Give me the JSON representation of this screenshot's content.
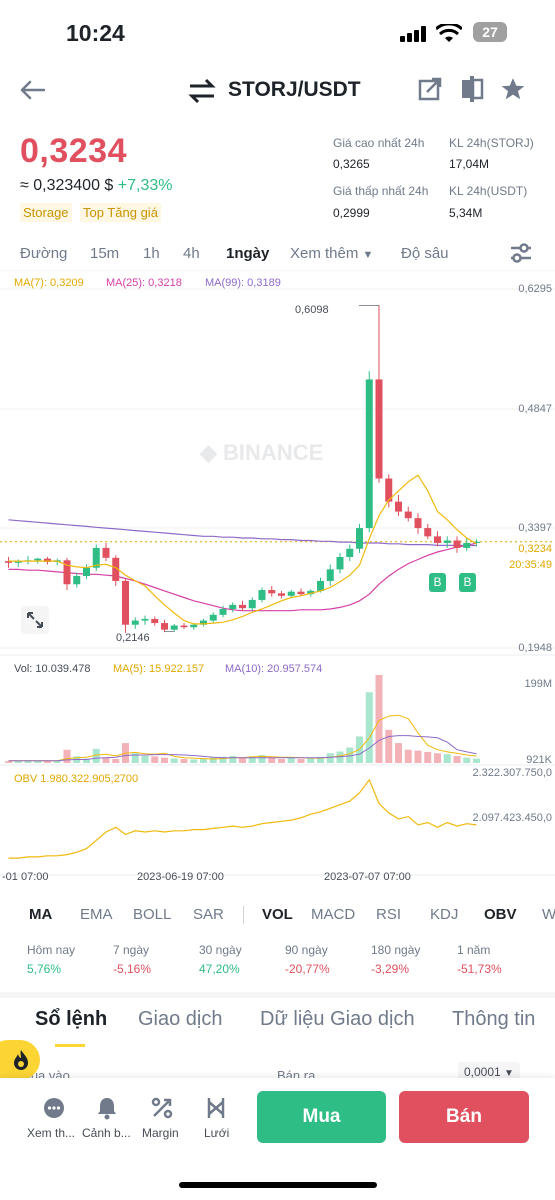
{
  "status": {
    "time": "10:24",
    "battery": "27"
  },
  "header": {
    "pair": "STORJ/USDT"
  },
  "price": {
    "last": "0,3234",
    "approx": "≈ 0,323400 $",
    "change": "+7,33%",
    "tags": [
      "Storage",
      "Top Tăng giá"
    ]
  },
  "stats": {
    "high_label": "Giá cao nhất 24h",
    "high": "0,3265",
    "low_label": "Giá thấp nhất 24h",
    "low": "0,2999",
    "vol_base_label": "KL 24h(STORJ)",
    "vol_base": "17,04M",
    "vol_quote_label": "KL 24h(USDT)",
    "vol_quote": "5,34M"
  },
  "timeframes": [
    "Đường",
    "15m",
    "1h",
    "4h",
    "1ngày",
    "Xem thêm",
    "Độ sâu"
  ],
  "ma_legend": {
    "ma7": "MA(7): 0,3209",
    "ma25": "MA(25): 0,3218",
    "ma99": "MA(99): 0,3189"
  },
  "colors": {
    "up": "#2ebd85",
    "down": "#e0505e",
    "ma7": "#f0b90b",
    "ma25": "#d63fa8",
    "ma99": "#8e6ac8",
    "accent": "#fcd535"
  },
  "chart_data": [
    {
      "type": "candlestick",
      "title": "STORJ/USDT 1ngày",
      "y_ticks": [
        "0,6295",
        "0,4847",
        "0,3397",
        "0,1948"
      ],
      "ylim": [
        0.1948,
        0.6295
      ],
      "annotations": {
        "high": "0,6098",
        "low": "0,2146",
        "last": "0,3234",
        "countdown": "20:35:49"
      },
      "x_ticks": [
        "-01 07:00",
        "2023-06-19 07:00",
        "2023-07-07 07:00"
      ],
      "markers": [
        "B",
        "B"
      ],
      "candles": [
        [
          0.3,
          0.305,
          0.292,
          0.298
        ],
        [
          0.298,
          0.302,
          0.293,
          0.3
        ],
        [
          0.3,
          0.306,
          0.296,
          0.301
        ],
        [
          0.301,
          0.304,
          0.297,
          0.303
        ],
        [
          0.303,
          0.305,
          0.296,
          0.299
        ],
        [
          0.299,
          0.303,
          0.295,
          0.301
        ],
        [
          0.301,
          0.304,
          0.265,
          0.272
        ],
        [
          0.272,
          0.286,
          0.268,
          0.282
        ],
        [
          0.282,
          0.296,
          0.278,
          0.292
        ],
        [
          0.292,
          0.32,
          0.288,
          0.316
        ],
        [
          0.316,
          0.322,
          0.3,
          0.304
        ],
        [
          0.304,
          0.307,
          0.27,
          0.276
        ],
        [
          0.276,
          0.278,
          0.213,
          0.223
        ],
        [
          0.223,
          0.232,
          0.218,
          0.228
        ],
        [
          0.228,
          0.234,
          0.223,
          0.23
        ],
        [
          0.23,
          0.233,
          0.222,
          0.225
        ],
        [
          0.225,
          0.229,
          0.214,
          0.217
        ],
        [
          0.217,
          0.224,
          0.215,
          0.222
        ],
        [
          0.222,
          0.225,
          0.218,
          0.22
        ],
        [
          0.22,
          0.225,
          0.217,
          0.223
        ],
        [
          0.223,
          0.23,
          0.221,
          0.228
        ],
        [
          0.228,
          0.238,
          0.226,
          0.235
        ],
        [
          0.235,
          0.246,
          0.232,
          0.242
        ],
        [
          0.242,
          0.25,
          0.238,
          0.247
        ],
        [
          0.247,
          0.252,
          0.24,
          0.243
        ],
        [
          0.243,
          0.256,
          0.24,
          0.253
        ],
        [
          0.253,
          0.268,
          0.25,
          0.265
        ],
        [
          0.265,
          0.27,
          0.257,
          0.261
        ],
        [
          0.261,
          0.264,
          0.255,
          0.258
        ],
        [
          0.258,
          0.265,
          0.255,
          0.263
        ],
        [
          0.263,
          0.267,
          0.258,
          0.26
        ],
        [
          0.26,
          0.266,
          0.257,
          0.264
        ],
        [
          0.264,
          0.28,
          0.262,
          0.276
        ],
        [
          0.276,
          0.296,
          0.27,
          0.29
        ],
        [
          0.29,
          0.31,
          0.285,
          0.305
        ],
        [
          0.305,
          0.32,
          0.3,
          0.315
        ],
        [
          0.315,
          0.345,
          0.31,
          0.34
        ],
        [
          0.34,
          0.53,
          0.335,
          0.52
        ],
        [
          0.52,
          0.6098,
          0.395,
          0.4
        ],
        [
          0.4,
          0.405,
          0.365,
          0.372
        ],
        [
          0.372,
          0.38,
          0.355,
          0.36
        ],
        [
          0.36,
          0.366,
          0.348,
          0.352
        ],
        [
          0.352,
          0.358,
          0.333,
          0.34
        ],
        [
          0.34,
          0.345,
          0.327,
          0.33
        ],
        [
          0.33,
          0.336,
          0.318,
          0.322
        ],
        [
          0.322,
          0.33,
          0.316,
          0.325
        ],
        [
          0.325,
          0.33,
          0.31,
          0.316
        ],
        [
          0.316,
          0.328,
          0.312,
          0.322
        ],
        [
          0.322,
          0.3265,
          0.318,
          0.3234
        ]
      ],
      "ma7": [
        0.3,
        0.3,
        0.3,
        0.3,
        0.3,
        0.3,
        0.295,
        0.293,
        0.292,
        0.295,
        0.296,
        0.292,
        0.283,
        0.276,
        0.27,
        0.258,
        0.247,
        0.237,
        0.228,
        0.224,
        0.224,
        0.225,
        0.226,
        0.229,
        0.233,
        0.238,
        0.242,
        0.247,
        0.252,
        0.256,
        0.258,
        0.261,
        0.264,
        0.268,
        0.275,
        0.283,
        0.295,
        0.327,
        0.355,
        0.374,
        0.385,
        0.396,
        0.404,
        0.385,
        0.36,
        0.35,
        0.338,
        0.328,
        0.3209
      ],
      "ma25": [
        0.29,
        0.29,
        0.289,
        0.289,
        0.288,
        0.287,
        0.286,
        0.285,
        0.284,
        0.284,
        0.283,
        0.282,
        0.279,
        0.276,
        0.272,
        0.268,
        0.264,
        0.26,
        0.256,
        0.252,
        0.249,
        0.246,
        0.243,
        0.241,
        0.24,
        0.24,
        0.24,
        0.24,
        0.24,
        0.24,
        0.241,
        0.241,
        0.241,
        0.242,
        0.244,
        0.247,
        0.252,
        0.26,
        0.272,
        0.282,
        0.29,
        0.297,
        0.302,
        0.307,
        0.311,
        0.314,
        0.317,
        0.319,
        0.3218
      ],
      "ma99": [
        0.35,
        0.349,
        0.348,
        0.347,
        0.346,
        0.345,
        0.344,
        0.343,
        0.342,
        0.341,
        0.34,
        0.339,
        0.338,
        0.337,
        0.336,
        0.335,
        0.334,
        0.333,
        0.332,
        0.331,
        0.33,
        0.33,
        0.329,
        0.329,
        0.328,
        0.328,
        0.327,
        0.327,
        0.326,
        0.326,
        0.325,
        0.325,
        0.324,
        0.324,
        0.323,
        0.323,
        0.322,
        0.322,
        0.322,
        0.321,
        0.321,
        0.32,
        0.32,
        0.32,
        0.319,
        0.319,
        0.319,
        0.319,
        0.3189
      ]
    },
    {
      "type": "bar",
      "title": "Vol",
      "legend": {
        "vol": "Vol: 10.039.478",
        "ma5": "MA(5): 15.922.157",
        "ma10": "MA(10): 20.957.574"
      },
      "y_ticks": [
        "199M",
        "921K"
      ],
      "ylim": [
        0,
        199
      ],
      "values": [
        4,
        5,
        6,
        5,
        4,
        5,
        30,
        15,
        10,
        32,
        12,
        9,
        45,
        22,
        16,
        15,
        12,
        10,
        9,
        8,
        9,
        12,
        14,
        16,
        12,
        15,
        18,
        11,
        9,
        12,
        9,
        12,
        14,
        22,
        26,
        35,
        60,
        160,
        199,
        75,
        45,
        30,
        28,
        25,
        22,
        20,
        16,
        12,
        10
      ],
      "ma5": [
        5,
        5,
        5,
        5,
        5,
        5,
        10,
        12,
        13,
        18,
        20,
        16,
        22,
        24,
        21,
        20,
        22,
        15,
        12,
        11,
        10,
        9,
        10,
        12,
        12,
        14,
        15,
        14,
        13,
        13,
        12,
        11,
        11,
        13,
        16,
        21,
        31,
        57,
        96,
        106,
        108,
        100,
        68,
        40,
        30,
        25,
        22,
        18,
        15.9
      ],
      "ma10": [
        5,
        5,
        5,
        5,
        5,
        5,
        7,
        8,
        8,
        11,
        12,
        13,
        17,
        18,
        18,
        19,
        19,
        19,
        18,
        17,
        15,
        13,
        12,
        12,
        12,
        12,
        12,
        12,
        12,
        12,
        12,
        12,
        12,
        13,
        14,
        16,
        20,
        34,
        51,
        60,
        62,
        62,
        60,
        59,
        57,
        47,
        30,
        25,
        21
      ]
    },
    {
      "type": "line",
      "title": "OBV",
      "legend": "OBV 1.980.322.905,2700",
      "y_ticks": [
        "2.322.307.750,0",
        "2.097.423.450,0"
      ],
      "values": [
        1.7,
        1.7,
        1.71,
        1.71,
        1.72,
        1.72,
        1.73,
        1.75,
        1.78,
        1.85,
        1.92,
        1.96,
        1.9,
        1.93,
        1.92,
        1.93,
        1.92,
        1.93,
        1.93,
        1.94,
        1.94,
        1.95,
        1.96,
        1.97,
        1.96,
        1.97,
        1.99,
        2.0,
        2.01,
        2.02,
        2.04,
        2.07,
        2.09,
        2.12,
        2.15,
        2.18,
        2.25,
        2.36,
        2.16,
        2.08,
        2.03,
        2.05,
        1.98,
        2.0,
        1.96,
        2.0,
        1.97,
        1.99,
        1.98
      ]
    }
  ],
  "indicators_main": [
    "MA",
    "EMA",
    "BOLL",
    "SAR"
  ],
  "indicators_sub": [
    "VOL",
    "MACD",
    "RSI",
    "KDJ",
    "OBV",
    "W"
  ],
  "performance": [
    {
      "label": "Hôm nay",
      "value": "5,76%"
    },
    {
      "label": "7 ngày",
      "value": "-5,16%"
    },
    {
      "label": "30 ngày",
      "value": "47,20%"
    },
    {
      "label": "90 ngày",
      "value": "-20,77%"
    },
    {
      "label": "180 ngày",
      "value": "-3,29%"
    },
    {
      "label": "1 năm",
      "value": "-51,73%"
    }
  ],
  "section_tabs": [
    "Sổ lệnh",
    "Giao dịch",
    "Dữ liệu Giao dịch",
    "Thông tin"
  ],
  "orderbook": {
    "buy_label": "Mua vào",
    "sell_label": "Bán ra",
    "precision": "0,0001"
  },
  "bottom": {
    "more": "Xem th...",
    "alert": "Cảnh b...",
    "margin": "Margin",
    "grid": "Lưới",
    "buy": "Mua",
    "sell": "Bán"
  }
}
